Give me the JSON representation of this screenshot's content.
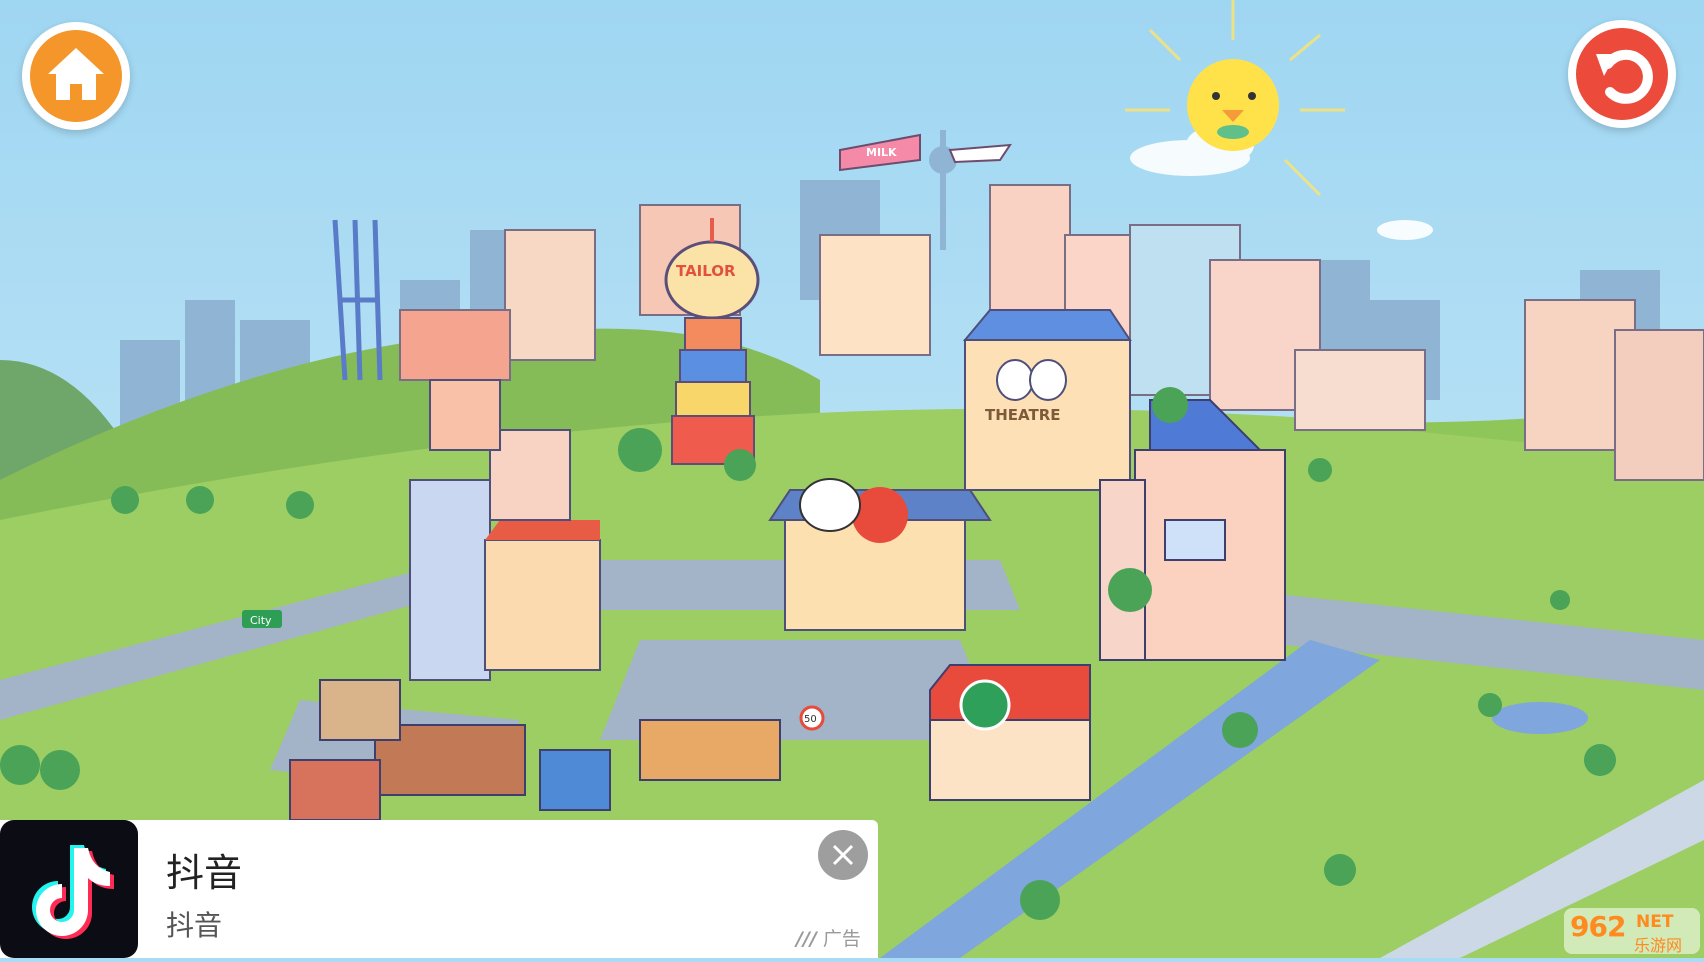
{
  "nav": {
    "home_icon": "home-icon",
    "undo_icon": "undo-icon"
  },
  "scene": {
    "signs": {
      "milk_banner": "MILK",
      "tailor": "TAILOR",
      "theatre": "THEATRE",
      "city": "City",
      "speed_limit": "50"
    }
  },
  "ad": {
    "title": "抖音",
    "subtitle": "抖音",
    "label": "广告",
    "close_icon": "close-icon",
    "app_icon": "tiktok-icon"
  },
  "watermark": {
    "logo": "962",
    "net": "NET",
    "cn": "乐游网"
  },
  "colors": {
    "sky": "#a9dcf4",
    "grass": "#8fc65a",
    "home_button": "#f5962a",
    "undo_button": "#ec4a3b",
    "sun": "#ffe14a",
    "road": "#9fb0c6"
  }
}
